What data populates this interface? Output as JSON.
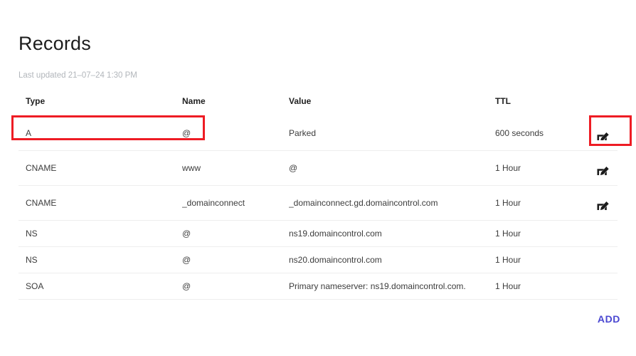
{
  "header": {
    "title": "Records",
    "last_updated": "Last updated 21–07–24 1:30 PM"
  },
  "table": {
    "columns": [
      {
        "key": "type",
        "label": "Type"
      },
      {
        "key": "name",
        "label": "Name"
      },
      {
        "key": "value",
        "label": "Value"
      },
      {
        "key": "ttl",
        "label": "TTL"
      }
    ],
    "rows": [
      {
        "type": "A",
        "name": "@",
        "value": "Parked",
        "ttl": "600 seconds",
        "edit_icon": "edit-pencil-square-icon",
        "has_edit": true,
        "highlighted": true
      },
      {
        "type": "CNAME",
        "name": "www",
        "value": "@",
        "ttl": "1 Hour",
        "edit_icon": "edit-pencil-square-icon",
        "has_edit": true,
        "highlighted": false
      },
      {
        "type": "CNAME",
        "name": "_domainconnect",
        "value": "_domainconnect.gd.domaincontrol.com",
        "ttl": "1 Hour",
        "edit_icon": "edit-pencil-square-icon",
        "has_edit": true,
        "highlighted": false
      },
      {
        "type": "NS",
        "name": "@",
        "value": "ns19.domaincontrol.com",
        "ttl": "1 Hour",
        "edit_icon": "",
        "has_edit": false,
        "highlighted": false
      },
      {
        "type": "NS",
        "name": "@",
        "value": "ns20.domaincontrol.com",
        "ttl": "1 Hour",
        "edit_icon": "",
        "has_edit": false,
        "highlighted": false
      },
      {
        "type": "SOA",
        "name": "@",
        "value": "Primary nameserver: ns19.domaincontrol.com.",
        "ttl": "1 Hour",
        "edit_icon": "",
        "has_edit": false,
        "highlighted": false
      }
    ]
  },
  "footer": {
    "add_label": "ADD"
  },
  "annotations": [
    {
      "name": "highlight-row-a-record",
      "color": "#ee1c24"
    },
    {
      "name": "highlight-edit-a-record",
      "color": "#ee1c24"
    }
  ],
  "colors": {
    "accent": "#4a47d1",
    "annotation": "#ee1c24",
    "divider": "#eeeeee",
    "muted_text": "#b2b6bb",
    "body_text": "#3c3c3c",
    "background": "#ffffff"
  }
}
